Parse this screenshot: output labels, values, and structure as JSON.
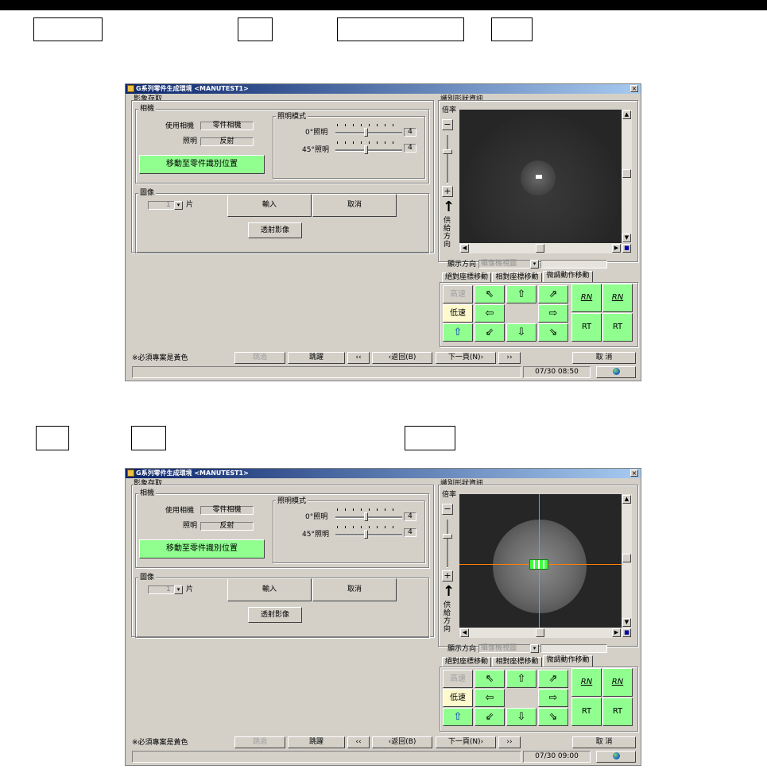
{
  "window": {
    "title": "G系列零件生成環境 <MANUTEST1>",
    "close": "×"
  },
  "sections": {
    "image_capture": "影象存取",
    "camera": "相機",
    "use_camera_label": "使用相機",
    "use_camera_value": "零件相機",
    "lighting_label": "照明",
    "lighting_value": "反射",
    "move_button": "移動至零件識別位置",
    "lighting_mode": "照明模式",
    "light0_label": "0°照明",
    "light0_value": "4",
    "light45_label": "45°照明",
    "light45_value": "4",
    "image": "圖像",
    "piece_value": "1",
    "piece_unit": "片",
    "input_button": "輸入",
    "cancel_button": "取消",
    "transmit_button": "透射影像"
  },
  "vision": {
    "title": "識別形狀資訊",
    "magnification": "倍率",
    "minus": "−",
    "plus": "+",
    "feed_arrow": "↑",
    "feed_direction": "供給方向",
    "display_direction_label": "顯示方向",
    "display_direction_value": "攝像機視圖"
  },
  "tabs": [
    "絕對座標移動",
    "相對座標移動",
    "微調動作移動"
  ],
  "move": {
    "high_speed": "高速",
    "low_speed": "低速",
    "rn_ccw": "RN",
    "rn_cw": "RN",
    "rt_ccw": "RT",
    "rt_cw": "RT"
  },
  "footer": {
    "note": "※必須專案是黃色",
    "skip": "跳過",
    "jump": "跳躍",
    "first": "‹‹",
    "back": "‹返回(B)",
    "next": "下一頁(N)›",
    "last": "››",
    "cancel": "取 消"
  },
  "screens": [
    {
      "time": "07/30 08:50"
    },
    {
      "time": "07/30 09:00"
    }
  ],
  "colors": {
    "green_button": "#90ff90",
    "crosshair": "#ff8000",
    "title_bar": "#0a246a"
  }
}
